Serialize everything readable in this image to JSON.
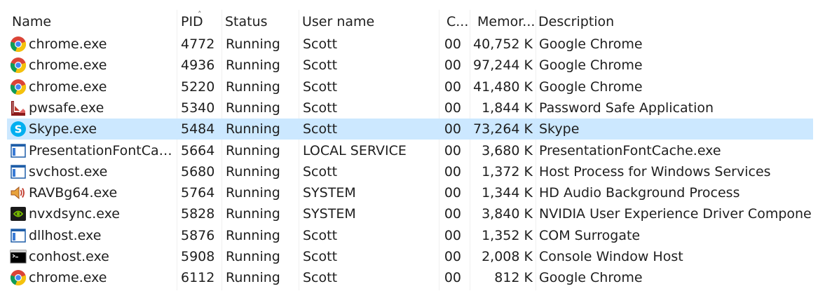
{
  "columns": {
    "name": "Name",
    "pid": "PID",
    "status": "Status",
    "user": "User name",
    "cpu": "C...",
    "memory": "Memor...",
    "description": "Description"
  },
  "rows": [
    {
      "icon": "chrome-icon",
      "name": "chrome.exe",
      "pid": "4772",
      "status": "Running",
      "user": "Scott",
      "cpu": "00",
      "memory": "40,752 K",
      "description": "Google Chrome"
    },
    {
      "icon": "chrome-icon",
      "name": "chrome.exe",
      "pid": "4936",
      "status": "Running",
      "user": "Scott",
      "cpu": "00",
      "memory": "97,244 K",
      "description": "Google Chrome"
    },
    {
      "icon": "chrome-icon",
      "name": "chrome.exe",
      "pid": "5220",
      "status": "Running",
      "user": "Scott",
      "cpu": "00",
      "memory": "41,480 K",
      "description": "Google Chrome"
    },
    {
      "icon": "pwsafe-icon",
      "name": "pwsafe.exe",
      "pid": "5340",
      "status": "Running",
      "user": "Scott",
      "cpu": "00",
      "memory": "1,844 K",
      "description": "Password Safe Application"
    },
    {
      "icon": "skype-icon",
      "name": "Skype.exe",
      "pid": "5484",
      "status": "Running",
      "user": "Scott",
      "cpu": "00",
      "memory": "73,264 K",
      "description": "Skype",
      "selected": true
    },
    {
      "icon": "window-app-icon",
      "name": "PresentationFontCache.exe",
      "pid": "5664",
      "status": "Running",
      "user": "LOCAL SERVICE",
      "cpu": "00",
      "memory": "3,680 K",
      "description": "PresentationFontCache.exe"
    },
    {
      "icon": "window-app-icon",
      "name": "svchost.exe",
      "pid": "5680",
      "status": "Running",
      "user": "Scott",
      "cpu": "00",
      "memory": "1,372 K",
      "description": "Host Process for Windows Services"
    },
    {
      "icon": "speaker-icon",
      "name": "RAVBg64.exe",
      "pid": "5764",
      "status": "Running",
      "user": "SYSTEM",
      "cpu": "00",
      "memory": "1,344 K",
      "description": "HD Audio Background Process"
    },
    {
      "icon": "nvidia-icon",
      "name": "nvxdsync.exe",
      "pid": "5828",
      "status": "Running",
      "user": "SYSTEM",
      "cpu": "00",
      "memory": "3,840 K",
      "description": "NVIDIA User Experience Driver Component"
    },
    {
      "icon": "window-app-icon",
      "name": "dllhost.exe",
      "pid": "5876",
      "status": "Running",
      "user": "Scott",
      "cpu": "00",
      "memory": "1,352 K",
      "description": "COM Surrogate"
    },
    {
      "icon": "console-icon",
      "name": "conhost.exe",
      "pid": "5908",
      "status": "Running",
      "user": "Scott",
      "cpu": "00",
      "memory": "2,008 K",
      "description": "Console Window Host"
    },
    {
      "icon": "chrome-icon",
      "name": "chrome.exe",
      "pid": "6112",
      "status": "Running",
      "user": "Scott",
      "cpu": "00",
      "memory": "812 K",
      "description": "Google Chrome"
    }
  ],
  "colors": {
    "selection": "#cce8ff",
    "chrome_red": "#db4437",
    "chrome_yellow": "#f4c20d",
    "chrome_green": "#0f9d58",
    "chrome_blue": "#4285f4",
    "skype_blue": "#00aff0",
    "nvidia_green": "#76b900"
  }
}
